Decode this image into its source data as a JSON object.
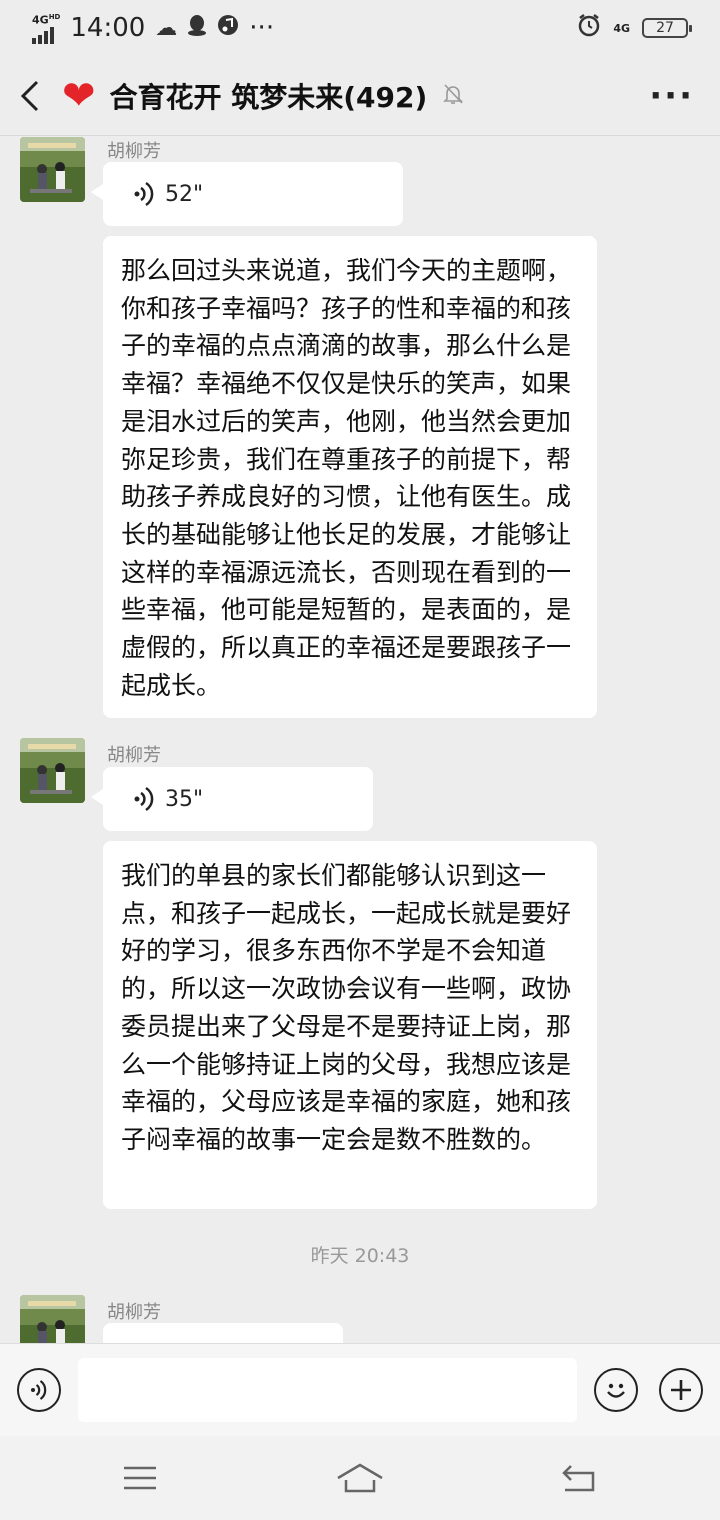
{
  "status_bar": {
    "network_left": "4G",
    "network_left_hd": "HD",
    "time": "14:00",
    "icons": [
      "cloud-icon",
      "qq-icon",
      "music-icon"
    ],
    "more": "···",
    "network_right": "4G",
    "battery": "27"
  },
  "header": {
    "title": "合育花开 筑梦未来(492)",
    "heart_icon": "❤",
    "more": "···"
  },
  "messages": [
    {
      "type": "voice",
      "sender": "胡柳芳",
      "duration": "52\""
    },
    {
      "type": "text",
      "text": "那么回过头来说道，我们今天的主题啊，你和孩子幸福吗？孩子的性和幸福的和孩子的幸福的点点滴滴的故事，那么什么是幸福？幸福绝不仅仅是快乐的笑声，如果是泪水过后的笑声，他刚，他当然会更加弥足珍贵，我们在尊重孩子的前提下，帮助孩子养成良好的习惯，让他有医生。成长的基础能够让他长足的发展，才能够让这样的幸福源远流长，否则现在看到的一些幸福，他可能是短暂的，是表面的，是虚假的，所以真正的幸福还是要跟孩子一起成长。"
    },
    {
      "type": "voice",
      "sender": "胡柳芳",
      "duration": "35\""
    },
    {
      "type": "text",
      "text": "我们的单县的家长们都能够认识到这一点，和孩子一起成长，一起成长就是要好好的学习，很多东西你不学是不会知道的，所以这一次政协会议有一些啊，政协委员提出来了父母是不是要持证上岗，那么一个能够持证上岗的父母，我想应该是幸福的，父母应该是幸福的家庭，她和孩子闷幸福的故事一定会是数不胜数的。"
    },
    {
      "type": "time",
      "text": "昨天 20:43"
    },
    {
      "type": "voice",
      "sender": "胡柳芳",
      "duration": ""
    }
  ],
  "input_bar": {
    "placeholder": ""
  },
  "colors": {
    "background": "#ededed",
    "bubble": "#ffffff",
    "heart": "#e3252a"
  }
}
